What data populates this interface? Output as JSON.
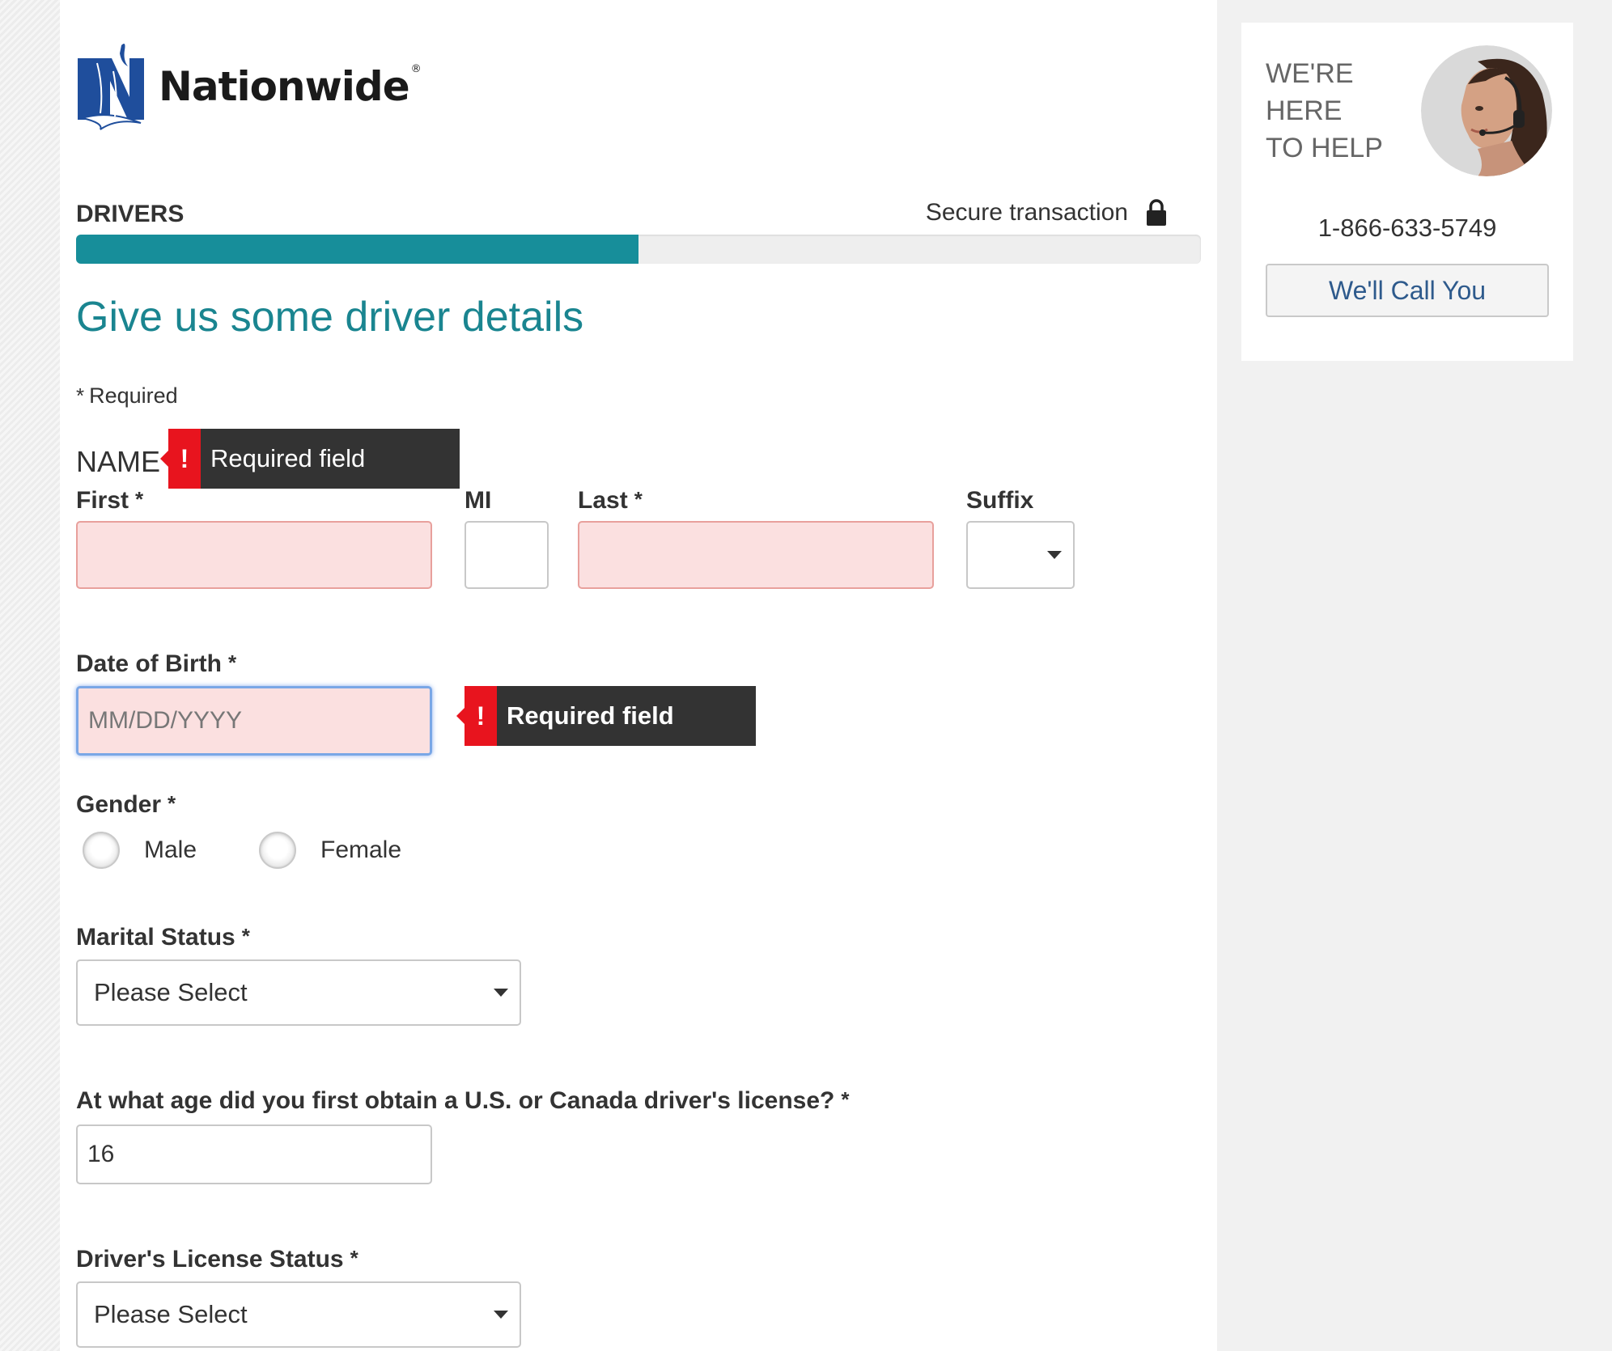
{
  "brand": {
    "name": "Nationwide",
    "registered_mark": "®",
    "icon": "nationwide-eagle-logo"
  },
  "header": {
    "step_label": "DRIVERS",
    "secure_text": "Secure transaction",
    "secure_icon": "lock-icon",
    "progress_fraction": 0.5
  },
  "page": {
    "title": "Give us some driver details",
    "required_note_star": "*",
    "required_note_text": "Required"
  },
  "name_section": {
    "heading": "NAME",
    "error_text": "Required field",
    "error_icon": "!",
    "first": {
      "label": "First",
      "star": "*",
      "value": ""
    },
    "mi": {
      "label": "MI",
      "value": ""
    },
    "last": {
      "label": "Last",
      "star": "*",
      "value": ""
    },
    "suffix": {
      "label": "Suffix",
      "value": ""
    }
  },
  "dob": {
    "label": "Date of Birth",
    "star": "*",
    "placeholder": "MM/DD/YYYY",
    "value": "",
    "error_text": "Required field",
    "error_icon": "!"
  },
  "gender": {
    "label": "Gender",
    "star": "*",
    "options": [
      "Male",
      "Female"
    ]
  },
  "marital_status": {
    "label": "Marital Status",
    "star": "*",
    "selected": "Please Select"
  },
  "license_age": {
    "label": "At what age did you first obtain a U.S. or Canada driver's license?",
    "star": "*",
    "value": "16"
  },
  "license_status": {
    "label": "Driver's License Status",
    "star": "*",
    "selected": "Please Select"
  },
  "sidebar": {
    "help_lines": [
      "WE'RE",
      "HERE",
      "TO HELP"
    ],
    "phone": "1-866-633-5749",
    "call_button": "We'll Call You",
    "avatar_icon": "support-agent-avatar"
  },
  "colors": {
    "accent": "#178e9a",
    "title": "#1a8590",
    "error": "#e8141e",
    "error_field_bg": "#fbe0e0",
    "tooltip_bg": "#333333",
    "link": "#2e5a8c"
  }
}
